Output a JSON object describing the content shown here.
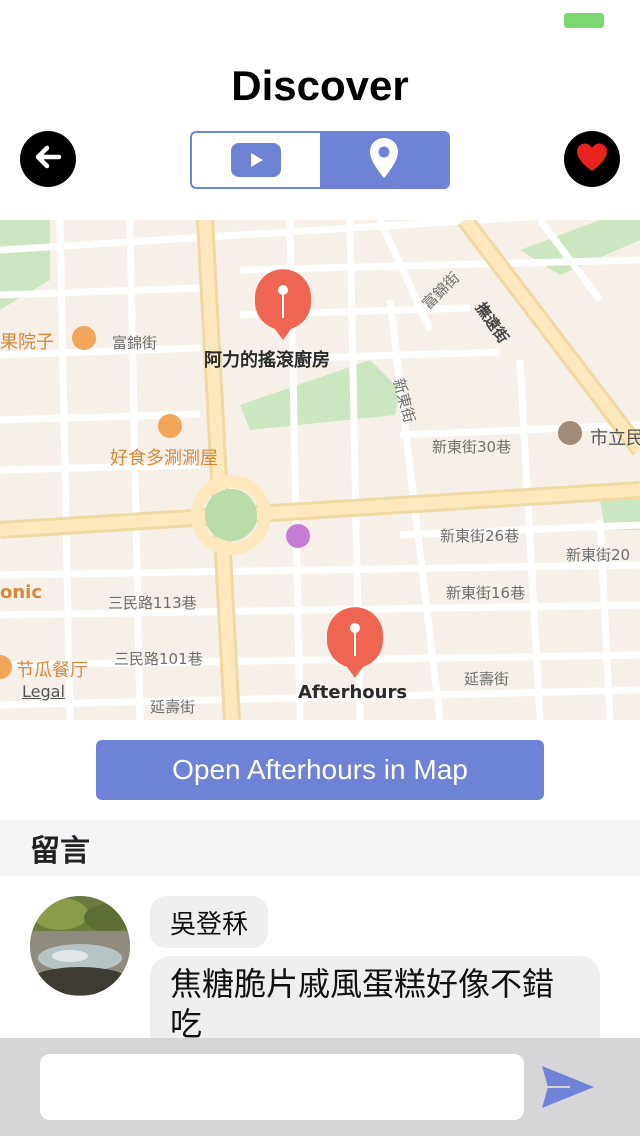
{
  "header": {
    "title": "Discover"
  },
  "segmented": {
    "options": [
      "video",
      "map"
    ],
    "selected": "map"
  },
  "icons": {
    "back": "arrow-left-icon",
    "favorite": "heart-icon",
    "video": "play-icon",
    "map": "map-pin-icon",
    "send": "send-icon"
  },
  "colors": {
    "accent": "#6f83d6",
    "pin": "#ee6552",
    "heart": "#e8231d",
    "battery": "#7bd870"
  },
  "map": {
    "labels": {
      "restaurant_1": "阿力的搖滾廚房",
      "fuchinjie_1": "富錦街",
      "fuchinjie_2": "富錦街",
      "orchard": "果院子",
      "haoshi": "好食多涮涮屋",
      "minsheng": "撫遠街",
      "xindong": "新東街",
      "xindong30": "新東街30巷",
      "school": "市立民",
      "xindong26": "新東街26巷",
      "xindong20": "新東街20",
      "xindong16": "新東街16巷",
      "tonic": "onic",
      "sanmin113": "三民路113巷",
      "sanmin101": "三民路101巷",
      "jiegua": "节瓜餐厅",
      "yanshou_1": "延壽街",
      "yanshou_2": "延壽街",
      "afterhours": "Afterhours",
      "legal": "Legal"
    }
  },
  "open_map_button": "Open Afterhours in Map",
  "comments": {
    "header": "留言",
    "items": [
      {
        "author": "吳登秝",
        "text": "焦糖脆片戚風蛋糕好像不錯吃"
      }
    ]
  },
  "input": {
    "placeholder": ""
  }
}
